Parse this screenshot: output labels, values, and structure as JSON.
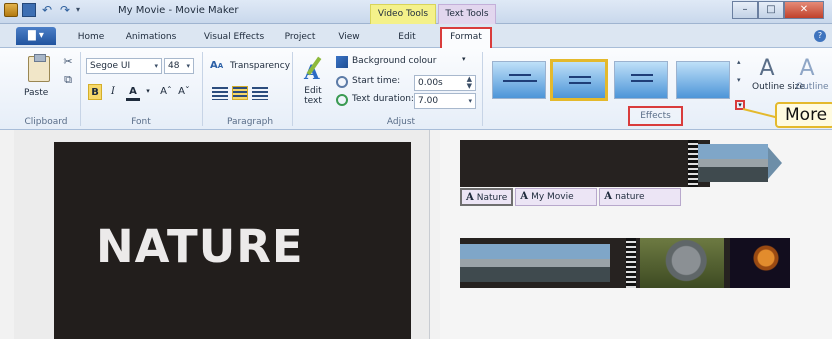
{
  "window": {
    "title": "My Movie - Movie Maker",
    "contextual_tabs": {
      "video_tools": "Video Tools",
      "text_tools": "Text Tools"
    },
    "controls": {
      "minimize": "–",
      "maximize": "□",
      "close": "✕"
    }
  },
  "tabs": {
    "file": "▇ ▾",
    "items": [
      "Home",
      "Animations",
      "Visual Effects",
      "Project",
      "View",
      "Edit",
      "Format"
    ],
    "active": "Format",
    "help": "?"
  },
  "ribbon": {
    "clipboard": {
      "paste": "Paste",
      "group_label": "Clipboard"
    },
    "font": {
      "family": "Segoe UI",
      "size": "48",
      "bold": "B",
      "italic": "I",
      "color": "A",
      "grow": "Aˆ",
      "shrink": "Aˇ",
      "transparency": "Transparency",
      "group_label": "Font"
    },
    "paragraph": {
      "group_label": "Paragraph"
    },
    "adjust": {
      "edit_text": "Edit text",
      "background_colour": "Background colour",
      "start_time_label": "Start time:",
      "start_time_value": "0.00s",
      "text_duration_label": "Text duration:",
      "text_duration_value": "7.00",
      "group_label": "Adjust"
    },
    "effects": {
      "group_label": "Effects",
      "outline_size": "Outline size",
      "outline_colour": "Outline",
      "more_callout": "More"
    }
  },
  "preview": {
    "caption": "NATURE"
  },
  "storyboard": {
    "captions": [
      {
        "icon": "A",
        "text": "Nature"
      },
      {
        "icon": "A",
        "text": "My Movie"
      },
      {
        "icon": "A",
        "text": "nature"
      }
    ]
  },
  "colors": {
    "accent_red": "#d93c3c",
    "video_tools": "#f4f18a",
    "text_tools": "#e2d6ee",
    "selection_gold": "#e4b92c"
  }
}
